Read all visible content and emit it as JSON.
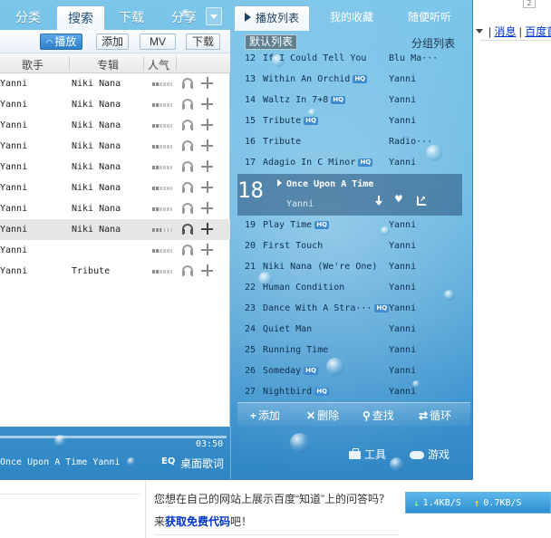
{
  "web_background": {
    "badge": "2",
    "links": [
      "消息",
      "百度首"
    ],
    "question": "您想在自己的网站上展示百度“知道”上的问答吗？",
    "cta_prefix": "来",
    "cta_link": "获取免费代码",
    "cta_suffix": "吧！"
  },
  "speed": {
    "down": "1.4KB/S",
    "up": "0.7KB/S"
  },
  "left_tabs": [
    "分类",
    "搜索",
    "下载",
    "分享"
  ],
  "right_tabs": [
    "播放列表",
    "我的收藏",
    "随便听听"
  ],
  "toolbar": {
    "play": "播放",
    "add": "添加",
    "mv": "MV",
    "download": "下载"
  },
  "columns": {
    "singer": "歌手",
    "album": "专辑",
    "popularity": "人气"
  },
  "search_results": [
    {
      "singer": "Yanni",
      "album": "Niki Nana",
      "pop": 0.3
    },
    {
      "singer": "Yanni",
      "album": "Niki Nana",
      "pop": 0.3
    },
    {
      "singer": "Yanni",
      "album": "Niki Nana",
      "pop": 0.3
    },
    {
      "singer": "Yanni",
      "album": "Niki Nana",
      "pop": 0.3
    },
    {
      "singer": "Yanni",
      "album": "Niki Nana",
      "pop": 0.3
    },
    {
      "singer": "Yanni",
      "album": "Niki Nana",
      "pop": 0.3
    },
    {
      "singer": "Yanni",
      "album": "Niki Nana",
      "pop": 0.3
    },
    {
      "singer": "Yanni",
      "album": "Niki Nana",
      "pop": 0.45
    },
    {
      "singer": "Yanni",
      "album": "",
      "pop": 0.3
    },
    {
      "singer": "Yanni",
      "album": "Tribute",
      "pop": 0.3
    }
  ],
  "playlist_header": {
    "default_list": "默认列表",
    "group_list": "分组列表"
  },
  "playlist": [
    {
      "num": "12",
      "title": "If I Could Tell You",
      "hq": false,
      "singer": "Blu Ma···"
    },
    {
      "num": "13",
      "title": "Within An Orchid",
      "hq": true,
      "singer": "Yanni"
    },
    {
      "num": "14",
      "title": "Waltz In 7+8",
      "hq": true,
      "singer": "Yanni"
    },
    {
      "num": "15",
      "title": "Tribute",
      "hq": true,
      "singer": "Yanni"
    },
    {
      "num": "16",
      "title": "Tribute",
      "hq": false,
      "singer": "Radio···"
    },
    {
      "num": "17",
      "title": "Adagio In C Minor",
      "hq": true,
      "singer": "Yanni"
    },
    {
      "num": "18",
      "title": "Once Upon A Time",
      "hq": false,
      "singer": "Yanni",
      "current": true
    },
    {
      "num": "19",
      "title": "Play Time",
      "hq": true,
      "singer": "Yanni"
    },
    {
      "num": "20",
      "title": "First Touch",
      "hq": false,
      "singer": "Yanni"
    },
    {
      "num": "21",
      "title": "Niki Nana (We're One)",
      "hq": false,
      "singer": "Yanni"
    },
    {
      "num": "22",
      "title": "Human Condition",
      "hq": false,
      "singer": "Yanni"
    },
    {
      "num": "23",
      "title": "Dance With A Stra···",
      "hq": true,
      "singer": "Yanni"
    },
    {
      "num": "24",
      "title": "Quiet Man",
      "hq": false,
      "singer": "Yanni"
    },
    {
      "num": "25",
      "title": "Running Time",
      "hq": false,
      "singer": "Yanni"
    },
    {
      "num": "26",
      "title": "Someday",
      "hq": true,
      "singer": "Yanni"
    },
    {
      "num": "27",
      "title": "Nightbird",
      "hq": true,
      "singer": "Yanni"
    }
  ],
  "hq_label": "HQ",
  "playlist_tools": {
    "add": "添加",
    "delete": "删除",
    "find": "查找",
    "loop": "循环"
  },
  "now_playing": {
    "elapsed": "03:50",
    "text": "Once Upon A Time Yanni",
    "eq": "EQ",
    "desktop_lyrics": "桌面歌词"
  },
  "bottom_tools": {
    "tools": "工具",
    "games": "游戏"
  },
  "colors": {
    "accent": "#2c7fc9",
    "skin": "#5bb0de",
    "hq_badge": "#3e8ccf"
  }
}
